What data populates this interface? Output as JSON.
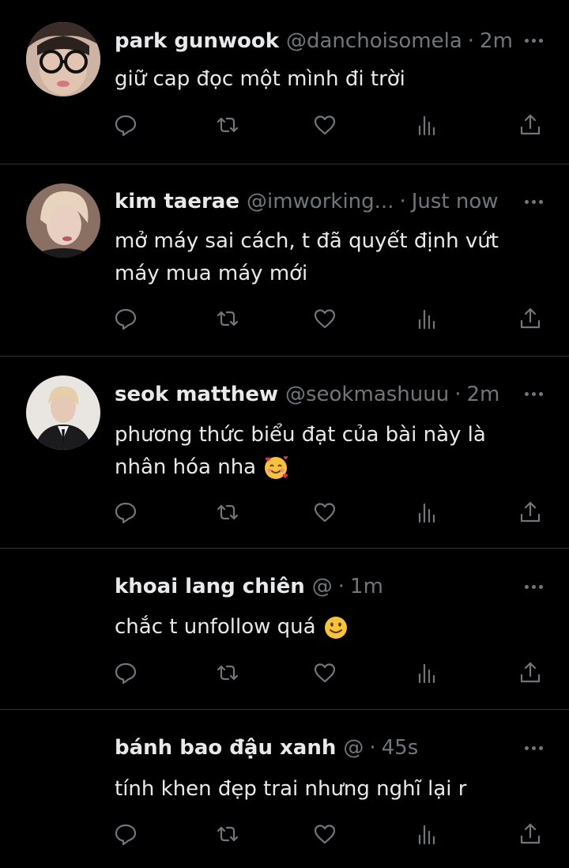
{
  "tweets": [
    {
      "name": "park gunwook",
      "handle": "@danchoisomela",
      "sep": "·",
      "time": "2m",
      "text_lines": [
        "giữ cap đọc một mình đi trời"
      ],
      "avatar": "photo-glasses"
    },
    {
      "name": "kim taerae",
      "handle": "@imworking...",
      "sep": "·",
      "time": "Just now",
      "text_lines": [
        "mở máy sai cách, t đã quyết định vứt",
        "máy mua máy mới"
      ],
      "avatar": "photo-blonde"
    },
    {
      "name": "seok matthew",
      "handle": "@seokmashuuu",
      "sep": "·",
      "time": "2m",
      "text_lines": [
        "phương thức biểu đạt của bài này là",
        "nhân hóa nha"
      ],
      "emoji": "smiling-face-with-hearts",
      "avatar": "photo-suit"
    },
    {
      "name": "khoai lang chiên",
      "handle": "@",
      "sep": "·",
      "time": "1m",
      "text_lines": [
        "chắc t unfollow quá"
      ],
      "emoji": "slightly-smiling-face"
    },
    {
      "name": "bánh bao đậu xanh",
      "handle": "@",
      "sep": "·",
      "time": "45s",
      "text_lines": [
        "tính khen đẹp trai nhưng nghĩ lại r"
      ]
    }
  ],
  "icons": [
    "reply-icon",
    "retweet-icon",
    "like-icon",
    "views-icon",
    "share-icon"
  ],
  "colors": {
    "background": "#000000",
    "text": "#e7e9ea",
    "muted": "#71767b",
    "divider": "#2f3336"
  }
}
